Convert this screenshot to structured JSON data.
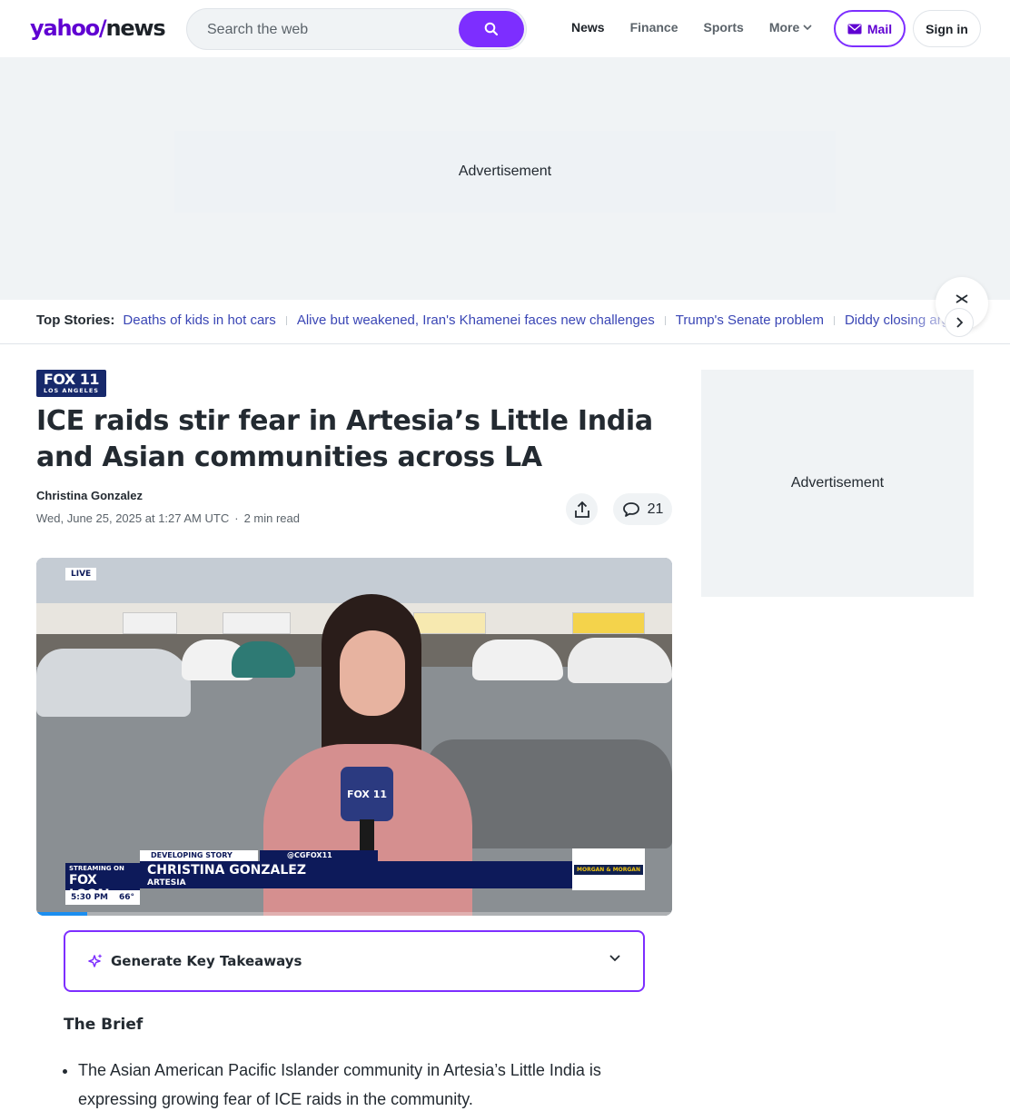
{
  "header": {
    "logo_yahoo": "yahoo/",
    "logo_news": "news",
    "search_placeholder": "Search the web",
    "nav": [
      {
        "label": "News"
      },
      {
        "label": "Finance"
      },
      {
        "label": "Sports"
      },
      {
        "label": "More"
      }
    ],
    "mail_label": "Mail",
    "signin_label": "Sign in"
  },
  "ads": {
    "top_label": "Advertisement",
    "right_label": "Advertisement"
  },
  "top_stories": {
    "label": "Top Stories:",
    "items": [
      "Deaths of kids in hot cars",
      "Alive but weakened, Iran's Khamenei faces new challenges",
      "Trump's Senate problem",
      "Diddy closing arguments"
    ]
  },
  "article": {
    "provider_logo_big": "FOX 11",
    "provider_logo_small": "LOS ANGELES",
    "headline": "ICE raids stir fear in Artesia’s Little India and Asian communities across LA",
    "author": "Christina Gonzalez",
    "date": "Wed, June 25, 2025 at 1:27 AM UTC",
    "read_time": "2 min read",
    "comment_count": "21"
  },
  "video": {
    "live_badge": "LIVE",
    "mic_label": "FOX 11",
    "streaming_on": "STREAMING ON",
    "fox_local": "FOX LOCAL",
    "time": "5:30 PM",
    "temp": "66°",
    "developing": "DEVELOPING STORY",
    "handle": "@CGFOX11",
    "reporter_name": "CHRISTINA GONZALEZ",
    "location": "ARTESIA",
    "sponsor": "MORGAN & MORGAN",
    "progress_fraction": 0.08
  },
  "takeaways": {
    "label": "Generate Key Takeaways"
  },
  "brief": {
    "title": "The Brief",
    "items": [
      "The Asian American Pacific Islander community in Artesia’s Little India is expressing growing fear of ICE raids in the community."
    ]
  },
  "colors": {
    "brand_purple": "#6001d2",
    "accent_purple": "#7d2eff",
    "link_blue": "#3a46b5",
    "fox_navy": "#0d1a5a"
  }
}
